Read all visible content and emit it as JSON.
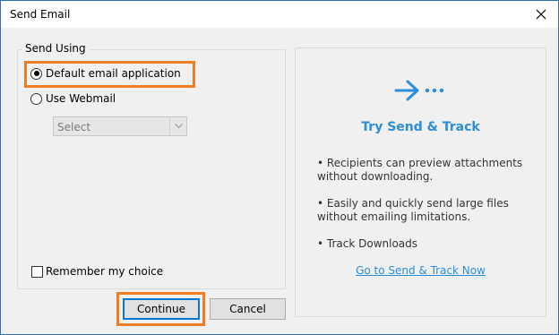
{
  "window": {
    "title": "Send Email"
  },
  "group": {
    "legend": "Send Using",
    "default_option_label": "Default email application",
    "webmail_option_label": "Use Webmail",
    "selected_option": "default",
    "webmail_select_value": "Select",
    "remember_label": "Remember my choice",
    "remember_checked": false
  },
  "buttons": {
    "continue_label": "Continue",
    "cancel_label": "Cancel"
  },
  "promo": {
    "icon": "arrow-right-dots-icon",
    "title": "Try Send & Track",
    "bullets": [
      "• Recipients can preview attachments without downloading.",
      "• Easily and quickly send large files without emailing limitations.",
      "• Track Downloads"
    ],
    "link_label": "Go to Send & Track Now"
  },
  "colors": {
    "highlight": "#ee7d23",
    "accent": "#2b8ed6",
    "window_border": "#2f6fb7"
  }
}
